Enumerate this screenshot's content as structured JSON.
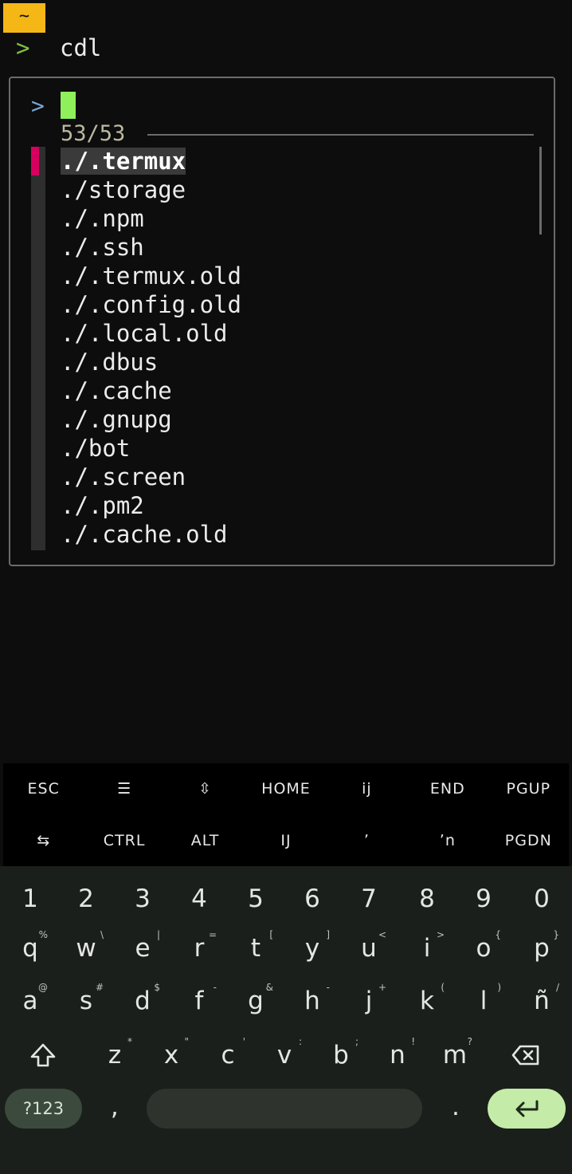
{
  "tab": {
    "label": "~"
  },
  "command": {
    "prompt_symbol": ">",
    "text": "cdl"
  },
  "fzf": {
    "prompt_symbol": ">",
    "query": "",
    "count": "53/53",
    "items": [
      "./.termux",
      "./storage",
      "./.npm",
      "./.ssh",
      "./.termux.old",
      "./.config.old",
      "./.local.old",
      "./.dbus",
      "./.cache",
      "./.gnupg",
      "./bot",
      "./.screen",
      "./.pm2",
      "./.cache.old"
    ],
    "selected_index": 0
  },
  "extra_keys": {
    "row1": [
      "ESC",
      "☰",
      "⇳",
      "HOME",
      "ij",
      "END",
      "PGUP"
    ],
    "row2": [
      "⇆",
      "CTRL",
      "ALT",
      "IJ",
      "ʼ",
      "ʼn",
      "PGDN"
    ]
  },
  "keyboard": {
    "numbers": [
      "1",
      "2",
      "3",
      "4",
      "5",
      "6",
      "7",
      "8",
      "9",
      "0"
    ],
    "row_q": [
      {
        "k": "q",
        "s": "%"
      },
      {
        "k": "w",
        "s": "\\"
      },
      {
        "k": "e",
        "s": "|"
      },
      {
        "k": "r",
        "s": "="
      },
      {
        "k": "t",
        "s": "["
      },
      {
        "k": "y",
        "s": "]"
      },
      {
        "k": "u",
        "s": "<"
      },
      {
        "k": "i",
        "s": ">"
      },
      {
        "k": "o",
        "s": "{"
      },
      {
        "k": "p",
        "s": "}"
      }
    ],
    "row_a": [
      {
        "k": "a",
        "s": "@"
      },
      {
        "k": "s",
        "s": "#"
      },
      {
        "k": "d",
        "s": "$"
      },
      {
        "k": "f",
        "s": "-"
      },
      {
        "k": "g",
        "s": "&"
      },
      {
        "k": "h",
        "s": "-"
      },
      {
        "k": "j",
        "s": "+"
      },
      {
        "k": "k",
        "s": "("
      },
      {
        "k": "l",
        "s": ")"
      },
      {
        "k": "ñ",
        "s": "/"
      }
    ],
    "row_z": [
      {
        "k": "z",
        "s": "*"
      },
      {
        "k": "x",
        "s": "\""
      },
      {
        "k": "c",
        "s": "'"
      },
      {
        "k": "v",
        "s": ":"
      },
      {
        "k": "b",
        "s": ";"
      },
      {
        "k": "n",
        "s": "!"
      },
      {
        "k": "m",
        "s": "?"
      }
    ],
    "symbols_label": "?123",
    "comma": ",",
    "period": "."
  }
}
